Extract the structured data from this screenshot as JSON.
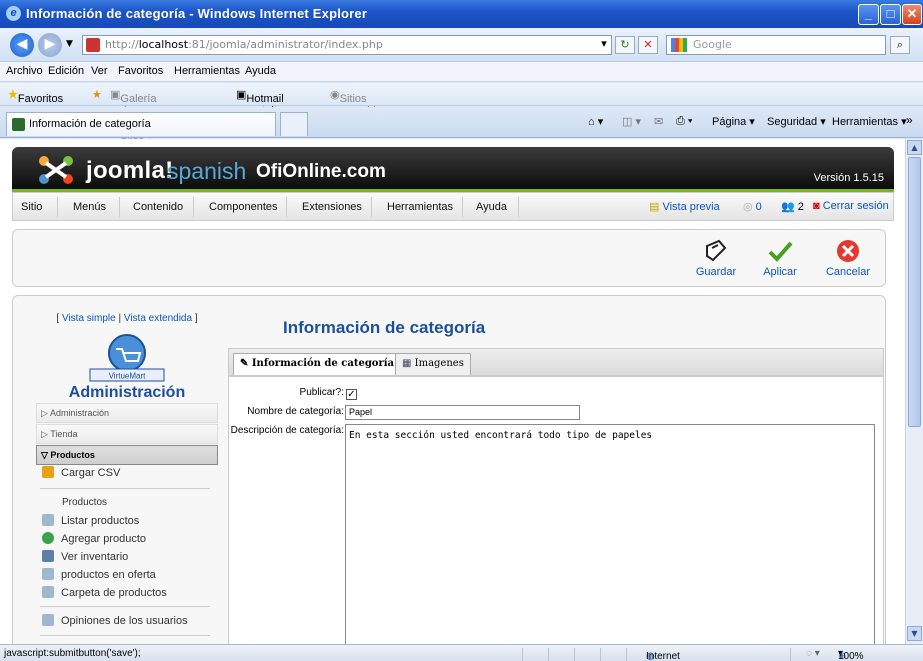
{
  "window": {
    "title": "Información de categoría - Windows Internet Explorer",
    "minimize": "_",
    "maximize": "□",
    "close": "✕"
  },
  "address": {
    "url_prefix": "http://",
    "url_host": "localhost",
    "url_rest": ":81/joomla/administrator/index.php",
    "search_placeholder": "Google"
  },
  "menubar": [
    "Archivo",
    "Edición",
    "Ver",
    "Favoritos",
    "Herramientas",
    "Ayuda"
  ],
  "favorites": {
    "label": "Favoritos",
    "items": [
      "Galería de Web Slice ▾",
      "Hotmail gratuito",
      "Sitios sugeridos ▾"
    ]
  },
  "tab": {
    "title": "Información de categoría"
  },
  "commandbar": [
    "Página ▾",
    "Seguridad ▾",
    "Herramientas ▾"
  ],
  "joomla": {
    "brand": "joomla!",
    "spanish": "spanish",
    "site": "OfiOnline.com",
    "version": "Versión 1.5.15",
    "menu": [
      "Sitio",
      "Menús",
      "Contenido",
      "Componentes",
      "Extensiones",
      "Herramientas",
      "Ayuda"
    ],
    "preview": "Vista previa",
    "msg_count": "0",
    "users_count": "2",
    "logout": "Cerrar sesión"
  },
  "toolbar": {
    "save": "Guardar",
    "apply": "Aplicar",
    "cancel": "Cancelar"
  },
  "sidebar": {
    "view_open": "[ ",
    "view_simple": "Vista simple",
    "view_sep": " | ",
    "view_extended": "Vista extendida",
    "view_close": " ]",
    "logo_text": "VirtueMart",
    "admin_title": "Administración",
    "sections": [
      "Administración",
      "Tienda",
      "Productos"
    ],
    "upload_csv": "Cargar CSV",
    "products_heading": "Productos",
    "product_items": [
      "Listar productos",
      "Agregar producto",
      "Ver inventario",
      "productos en oferta",
      "Carpeta de productos"
    ],
    "reviews": "Opiniones de los usuarios"
  },
  "content": {
    "title": "Información de categoría",
    "tabs": [
      "Información de categoría",
      "Imagenes"
    ],
    "labels": {
      "publish": "Publicar?:",
      "name": "Nombre de categoría:",
      "description": "Descripción de categoría:"
    },
    "publish_checked": true,
    "name_value": "Papel",
    "description_value": "En esta sección usted encontrará todo tipo de papeles"
  },
  "statusbar": {
    "text": "javascript:submitbutton('save');",
    "zone": "Internet",
    "zoom": "100%"
  }
}
